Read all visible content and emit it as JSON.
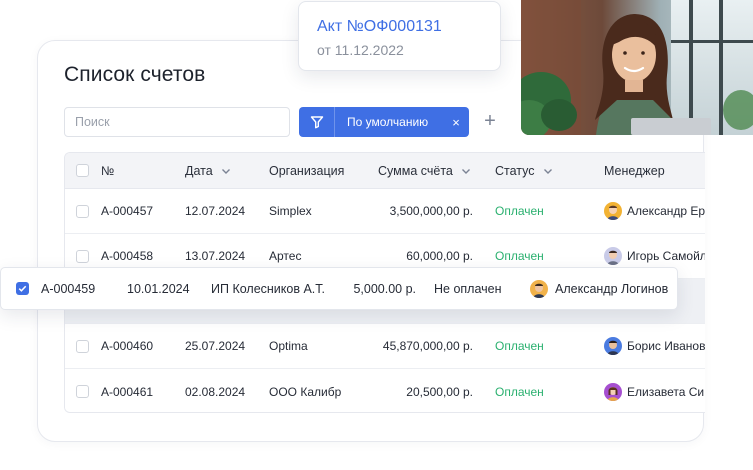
{
  "page": {
    "title": "Список счетов"
  },
  "search": {
    "placeholder": "Поиск",
    "value": ""
  },
  "filter": {
    "label": "По умолчанию",
    "close_glyph": "×",
    "icon": "filter-icon"
  },
  "add": {
    "glyph": "+"
  },
  "table": {
    "columns": [
      {
        "label": "№",
        "sortable": false
      },
      {
        "label": "Дата",
        "sortable": true
      },
      {
        "label": "Организация",
        "sortable": false
      },
      {
        "label": "Сумма счёта",
        "sortable": true
      },
      {
        "label": "Статус",
        "sortable": true
      },
      {
        "label": "Менеджер",
        "sortable": false
      }
    ],
    "rows": [
      {
        "number": "А-000457",
        "date": "12.07.2024",
        "org": "Simplex",
        "amount": "3,500,000,00 р.",
        "status": "Оплачен",
        "manager": "Александр Ер"
      },
      {
        "number": "А-000458",
        "date": "13.07.2024",
        "org": "Артес",
        "amount": "60,000,00 р.",
        "status": "Оплачен",
        "manager": "Игорь Самойл"
      },
      {
        "number": "А-000460",
        "date": "25.07.2024",
        "org": "Optima",
        "amount": "45,870,000,00 р.",
        "status": "Оплачен",
        "manager": "Борис Иванов"
      },
      {
        "number": "А-000461",
        "date": "02.08.2024",
        "org": "ООО Калибр",
        "amount": "20,500,00 р.",
        "status": "Оплачен",
        "manager": "Елизавета Си"
      }
    ]
  },
  "selected_row": {
    "checked": true,
    "number": "А-000459",
    "date": "10.01.2024",
    "org": "ИП Колесников А.Т.",
    "amount": "5,000.00 р.",
    "status": "Не оплачен",
    "manager": "Александр Логинов"
  },
  "act_card": {
    "title": "Акт №ОФ000131",
    "date": "от 11.12.2022"
  },
  "colors": {
    "accent": "#3f6fe4",
    "paid": "#2ab06f",
    "unpaid": "#ec5a63"
  }
}
